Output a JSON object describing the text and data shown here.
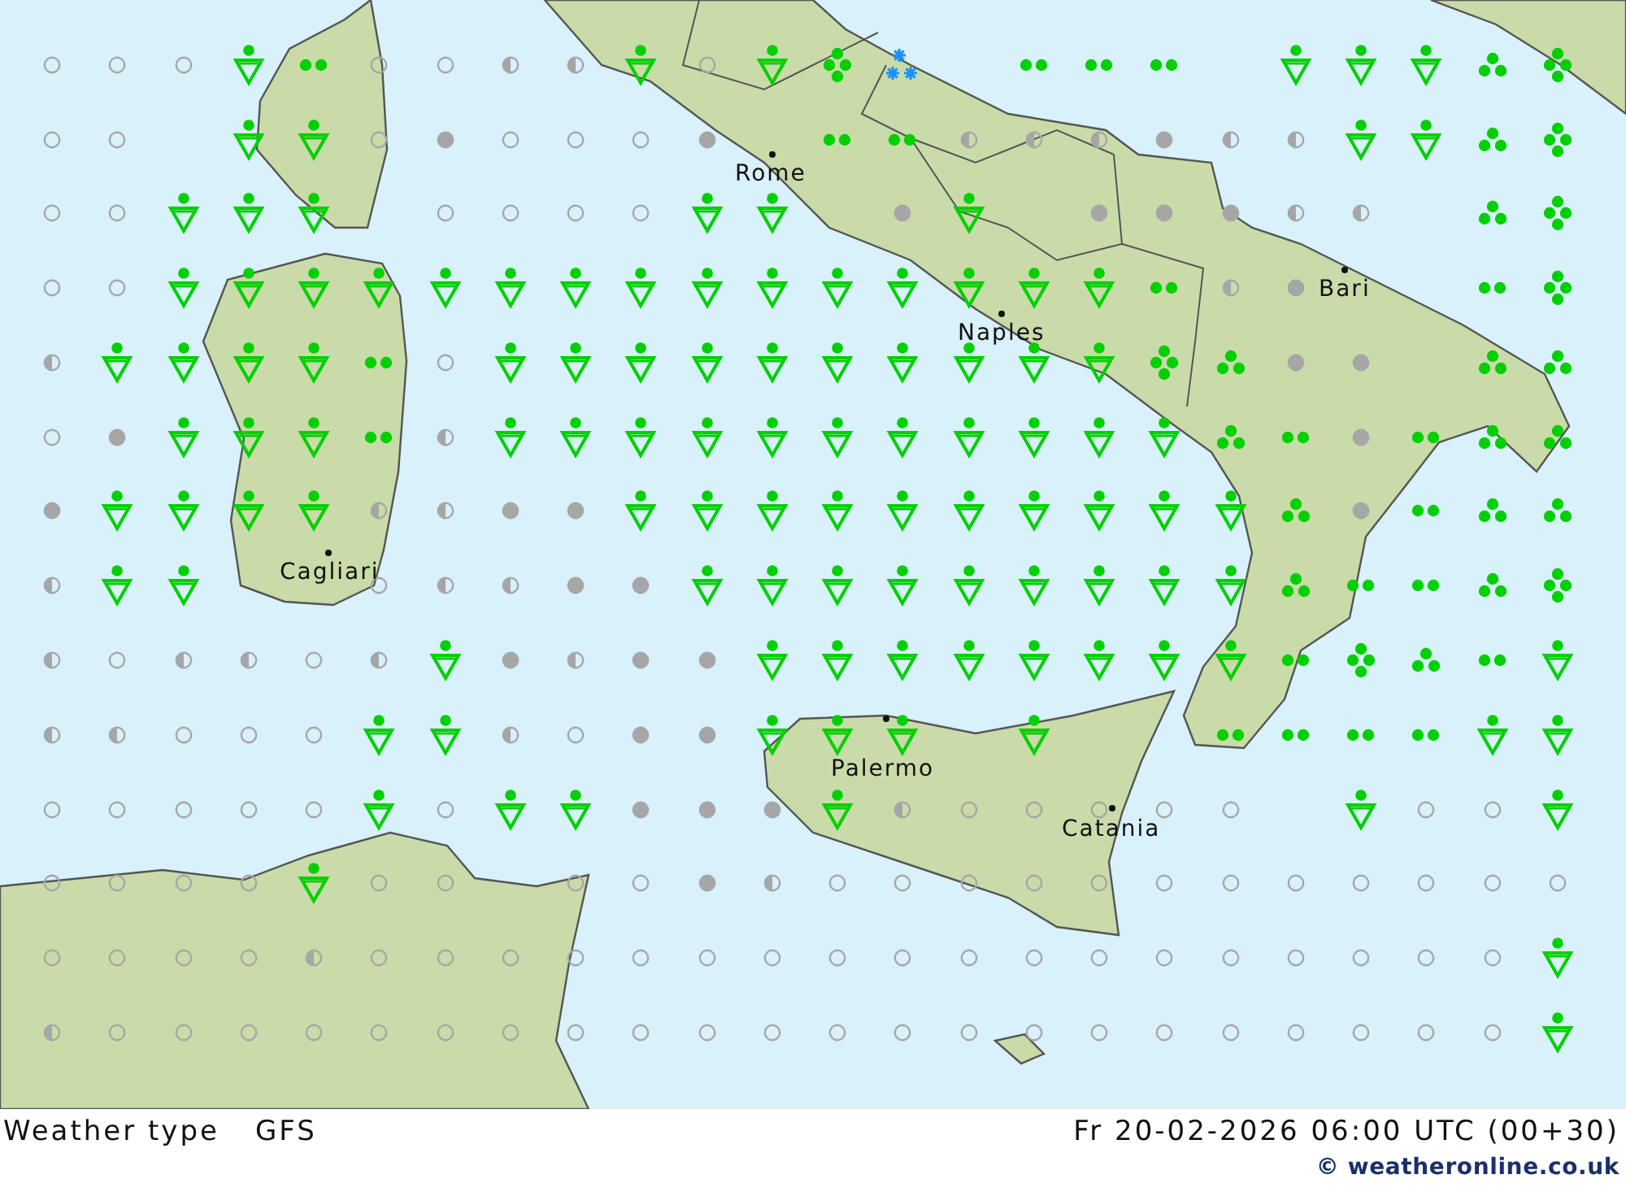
{
  "map": {
    "cities": [
      {
        "name": "Rome"
      },
      {
        "name": "Bari"
      },
      {
        "name": "Naples"
      },
      {
        "name": "Cagliari"
      },
      {
        "name": "Palermo"
      },
      {
        "name": "Catania"
      }
    ],
    "grid": [
      [
        {
          "kind": "clear"
        },
        {
          "kind": "clear"
        },
        {
          "kind": "clear"
        },
        {
          "kind": "shower"
        },
        {
          "kind": "drizzle"
        },
        {
          "kind": "clear"
        },
        {
          "kind": "clear"
        },
        {
          "kind": "partly"
        },
        {
          "kind": "partly"
        },
        {
          "kind": "shower"
        },
        {
          "kind": "clear"
        },
        {
          "kind": "shower"
        },
        {
          "kind": "heavy"
        },
        {
          "kind": "snow"
        },
        {
          "kind": "none"
        },
        {
          "kind": "drizzle"
        },
        {
          "kind": "drizzle"
        },
        {
          "kind": "drizzle"
        },
        {
          "kind": "none"
        },
        {
          "kind": "shower"
        },
        {
          "kind": "shower"
        },
        {
          "kind": "shower"
        },
        {
          "kind": "rain"
        },
        {
          "kind": "heavy"
        }
      ],
      [
        {
          "kind": "clear"
        },
        {
          "kind": "clear"
        },
        {
          "kind": "none"
        },
        {
          "kind": "shower"
        },
        {
          "kind": "shower"
        },
        {
          "kind": "clear"
        },
        {
          "kind": "overcast"
        },
        {
          "kind": "clear"
        },
        {
          "kind": "clear"
        },
        {
          "kind": "clear"
        },
        {
          "kind": "overcast"
        },
        {
          "kind": "none"
        },
        {
          "kind": "drizzle"
        },
        {
          "kind": "drizzle"
        },
        {
          "kind": "partly"
        },
        {
          "kind": "partly"
        },
        {
          "kind": "partly"
        },
        {
          "kind": "overcast"
        },
        {
          "kind": "partly"
        },
        {
          "kind": "partly"
        },
        {
          "kind": "shower"
        },
        {
          "kind": "shower"
        },
        {
          "kind": "rain"
        },
        {
          "kind": "heavy"
        }
      ],
      [
        {
          "kind": "clear"
        },
        {
          "kind": "clear"
        },
        {
          "kind": "shower"
        },
        {
          "kind": "shower"
        },
        {
          "kind": "shower"
        },
        {
          "kind": "none"
        },
        {
          "kind": "clear"
        },
        {
          "kind": "clear"
        },
        {
          "kind": "clear"
        },
        {
          "kind": "clear"
        },
        {
          "kind": "shower"
        },
        {
          "kind": "shower"
        },
        {
          "kind": "none"
        },
        {
          "kind": "overcast"
        },
        {
          "kind": "shower"
        },
        {
          "kind": "none"
        },
        {
          "kind": "overcast"
        },
        {
          "kind": "overcast"
        },
        {
          "kind": "overcast"
        },
        {
          "kind": "partly"
        },
        {
          "kind": "partly"
        },
        {
          "kind": "none"
        },
        {
          "kind": "rain"
        },
        {
          "kind": "heavy"
        }
      ],
      [
        {
          "kind": "clear"
        },
        {
          "kind": "clear"
        },
        {
          "kind": "shower"
        },
        {
          "kind": "shower"
        },
        {
          "kind": "shower"
        },
        {
          "kind": "shower"
        },
        {
          "kind": "shower"
        },
        {
          "kind": "shower"
        },
        {
          "kind": "shower"
        },
        {
          "kind": "shower"
        },
        {
          "kind": "shower"
        },
        {
          "kind": "shower"
        },
        {
          "kind": "shower"
        },
        {
          "kind": "shower"
        },
        {
          "kind": "shower"
        },
        {
          "kind": "shower"
        },
        {
          "kind": "shower"
        },
        {
          "kind": "drizzle"
        },
        {
          "kind": "partly"
        },
        {
          "kind": "overcast"
        },
        {
          "kind": "none"
        },
        {
          "kind": "none"
        },
        {
          "kind": "drizzle"
        },
        {
          "kind": "heavy"
        }
      ],
      [
        {
          "kind": "partly"
        },
        {
          "kind": "shower"
        },
        {
          "kind": "shower"
        },
        {
          "kind": "shower"
        },
        {
          "kind": "shower"
        },
        {
          "kind": "drizzle"
        },
        {
          "kind": "clear"
        },
        {
          "kind": "shower"
        },
        {
          "kind": "shower"
        },
        {
          "kind": "shower"
        },
        {
          "kind": "shower"
        },
        {
          "kind": "shower"
        },
        {
          "kind": "shower"
        },
        {
          "kind": "shower"
        },
        {
          "kind": "shower"
        },
        {
          "kind": "shower"
        },
        {
          "kind": "shower"
        },
        {
          "kind": "heavy"
        },
        {
          "kind": "rain"
        },
        {
          "kind": "overcast"
        },
        {
          "kind": "overcast"
        },
        {
          "kind": "none"
        },
        {
          "kind": "rain"
        },
        {
          "kind": "rain"
        }
      ],
      [
        {
          "kind": "clear"
        },
        {
          "kind": "overcast"
        },
        {
          "kind": "shower"
        },
        {
          "kind": "shower"
        },
        {
          "kind": "shower"
        },
        {
          "kind": "drizzle"
        },
        {
          "kind": "partly"
        },
        {
          "kind": "shower"
        },
        {
          "kind": "shower"
        },
        {
          "kind": "shower"
        },
        {
          "kind": "shower"
        },
        {
          "kind": "shower"
        },
        {
          "kind": "shower"
        },
        {
          "kind": "shower"
        },
        {
          "kind": "shower"
        },
        {
          "kind": "shower"
        },
        {
          "kind": "shower"
        },
        {
          "kind": "shower"
        },
        {
          "kind": "rain"
        },
        {
          "kind": "drizzle"
        },
        {
          "kind": "overcast"
        },
        {
          "kind": "drizzle"
        },
        {
          "kind": "rain"
        },
        {
          "kind": "rain"
        }
      ],
      [
        {
          "kind": "overcast"
        },
        {
          "kind": "shower"
        },
        {
          "kind": "shower"
        },
        {
          "kind": "shower"
        },
        {
          "kind": "shower"
        },
        {
          "kind": "partly"
        },
        {
          "kind": "partly"
        },
        {
          "kind": "overcast"
        },
        {
          "kind": "overcast"
        },
        {
          "kind": "shower"
        },
        {
          "kind": "shower"
        },
        {
          "kind": "shower"
        },
        {
          "kind": "shower"
        },
        {
          "kind": "shower"
        },
        {
          "kind": "shower"
        },
        {
          "kind": "shower"
        },
        {
          "kind": "shower"
        },
        {
          "kind": "shower"
        },
        {
          "kind": "shower"
        },
        {
          "kind": "rain"
        },
        {
          "kind": "overcast"
        },
        {
          "kind": "drizzle"
        },
        {
          "kind": "rain"
        },
        {
          "kind": "rain"
        }
      ],
      [
        {
          "kind": "partly"
        },
        {
          "kind": "shower"
        },
        {
          "kind": "shower"
        },
        {
          "kind": "none"
        },
        {
          "kind": "none"
        },
        {
          "kind": "clear"
        },
        {
          "kind": "partly"
        },
        {
          "kind": "partly"
        },
        {
          "kind": "overcast"
        },
        {
          "kind": "overcast"
        },
        {
          "kind": "shower"
        },
        {
          "kind": "shower"
        },
        {
          "kind": "shower"
        },
        {
          "kind": "shower"
        },
        {
          "kind": "shower"
        },
        {
          "kind": "shower"
        },
        {
          "kind": "shower"
        },
        {
          "kind": "shower"
        },
        {
          "kind": "shower"
        },
        {
          "kind": "rain"
        },
        {
          "kind": "drizzle"
        },
        {
          "kind": "drizzle"
        },
        {
          "kind": "rain"
        },
        {
          "kind": "heavy"
        }
      ],
      [
        {
          "kind": "partly"
        },
        {
          "kind": "clear"
        },
        {
          "kind": "partly"
        },
        {
          "kind": "partly"
        },
        {
          "kind": "clear"
        },
        {
          "kind": "partly"
        },
        {
          "kind": "shower"
        },
        {
          "kind": "overcast"
        },
        {
          "kind": "partly"
        },
        {
          "kind": "overcast"
        },
        {
          "kind": "overcast"
        },
        {
          "kind": "shower"
        },
        {
          "kind": "shower"
        },
        {
          "kind": "shower"
        },
        {
          "kind": "shower"
        },
        {
          "kind": "shower"
        },
        {
          "kind": "shower"
        },
        {
          "kind": "shower"
        },
        {
          "kind": "shower"
        },
        {
          "kind": "drizzle"
        },
        {
          "kind": "heavy"
        },
        {
          "kind": "rain"
        },
        {
          "kind": "drizzle"
        },
        {
          "kind": "shower"
        }
      ],
      [
        {
          "kind": "partly"
        },
        {
          "kind": "partly"
        },
        {
          "kind": "clear"
        },
        {
          "kind": "clear"
        },
        {
          "kind": "clear"
        },
        {
          "kind": "shower"
        },
        {
          "kind": "shower"
        },
        {
          "kind": "partly"
        },
        {
          "kind": "clear"
        },
        {
          "kind": "overcast"
        },
        {
          "kind": "overcast"
        },
        {
          "kind": "shower"
        },
        {
          "kind": "shower"
        },
        {
          "kind": "shower"
        },
        {
          "kind": "none"
        },
        {
          "kind": "shower"
        },
        {
          "kind": "none"
        },
        {
          "kind": "none"
        },
        {
          "kind": "drizzle"
        },
        {
          "kind": "drizzle"
        },
        {
          "kind": "drizzle"
        },
        {
          "kind": "drizzle"
        },
        {
          "kind": "shower"
        },
        {
          "kind": "shower"
        }
      ],
      [
        {
          "kind": "clear"
        },
        {
          "kind": "clear"
        },
        {
          "kind": "clear"
        },
        {
          "kind": "clear"
        },
        {
          "kind": "clear"
        },
        {
          "kind": "shower"
        },
        {
          "kind": "clear"
        },
        {
          "kind": "shower"
        },
        {
          "kind": "shower"
        },
        {
          "kind": "overcast"
        },
        {
          "kind": "overcast"
        },
        {
          "kind": "overcast"
        },
        {
          "kind": "shower"
        },
        {
          "kind": "partly"
        },
        {
          "kind": "clear"
        },
        {
          "kind": "clear"
        },
        {
          "kind": "clear"
        },
        {
          "kind": "clear"
        },
        {
          "kind": "clear"
        },
        {
          "kind": "none"
        },
        {
          "kind": "shower"
        },
        {
          "kind": "clear"
        },
        {
          "kind": "clear"
        },
        {
          "kind": "shower"
        }
      ],
      [
        {
          "kind": "clear"
        },
        {
          "kind": "clear"
        },
        {
          "kind": "clear"
        },
        {
          "kind": "clear"
        },
        {
          "kind": "shower"
        },
        {
          "kind": "clear"
        },
        {
          "kind": "clear"
        },
        {
          "kind": "none"
        },
        {
          "kind": "clear"
        },
        {
          "kind": "clear"
        },
        {
          "kind": "overcast"
        },
        {
          "kind": "partly"
        },
        {
          "kind": "clear"
        },
        {
          "kind": "clear"
        },
        {
          "kind": "clear"
        },
        {
          "kind": "clear"
        },
        {
          "kind": "clear"
        },
        {
          "kind": "clear"
        },
        {
          "kind": "clear"
        },
        {
          "kind": "clear"
        },
        {
          "kind": "clear"
        },
        {
          "kind": "clear"
        },
        {
          "kind": "clear"
        },
        {
          "kind": "clear"
        }
      ],
      [
        {
          "kind": "clear"
        },
        {
          "kind": "clear"
        },
        {
          "kind": "clear"
        },
        {
          "kind": "clear"
        },
        {
          "kind": "partly"
        },
        {
          "kind": "clear"
        },
        {
          "kind": "clear"
        },
        {
          "kind": "clear"
        },
        {
          "kind": "clear"
        },
        {
          "kind": "clear"
        },
        {
          "kind": "clear"
        },
        {
          "kind": "clear"
        },
        {
          "kind": "clear"
        },
        {
          "kind": "clear"
        },
        {
          "kind": "clear"
        },
        {
          "kind": "clear"
        },
        {
          "kind": "clear"
        },
        {
          "kind": "clear"
        },
        {
          "kind": "clear"
        },
        {
          "kind": "clear"
        },
        {
          "kind": "clear"
        },
        {
          "kind": "clear"
        },
        {
          "kind": "clear"
        },
        {
          "kind": "shower"
        }
      ],
      [
        {
          "kind": "partly"
        },
        {
          "kind": "clear"
        },
        {
          "kind": "clear"
        },
        {
          "kind": "clear"
        },
        {
          "kind": "clear"
        },
        {
          "kind": "clear"
        },
        {
          "kind": "clear"
        },
        {
          "kind": "clear"
        },
        {
          "kind": "clear"
        },
        {
          "kind": "clear"
        },
        {
          "kind": "clear"
        },
        {
          "kind": "clear"
        },
        {
          "kind": "clear"
        },
        {
          "kind": "clear"
        },
        {
          "kind": "clear"
        },
        {
          "kind": "clear"
        },
        {
          "kind": "clear"
        },
        {
          "kind": "clear"
        },
        {
          "kind": "clear"
        },
        {
          "kind": "clear"
        },
        {
          "kind": "clear"
        },
        {
          "kind": "clear"
        },
        {
          "kind": "clear"
        },
        {
          "kind": "shower"
        }
      ]
    ]
  },
  "footer": {
    "title": "Weather type",
    "model": "GFS",
    "valid_time": "Fr 20-02-2026 06:00 UTC (00+30)",
    "credit": "© weatheronline.co.uk"
  }
}
